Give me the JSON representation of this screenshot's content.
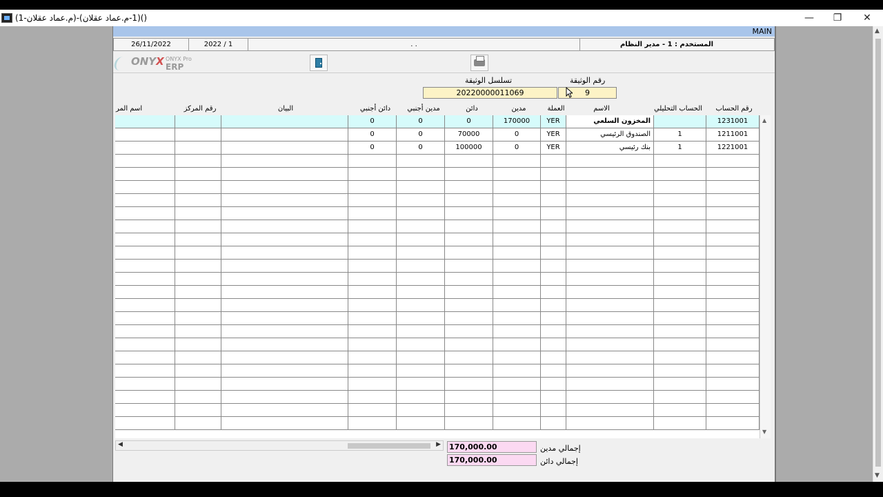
{
  "window": {
    "title": "(1-م.عماد عقلان)-(1-م.عماد عقلان)()",
    "minimize": "—",
    "restore": "❐",
    "close": "✕"
  },
  "form": {
    "main_label": "MAIN",
    "status": {
      "date": "26/11/2022",
      "period": "2022 / 1",
      "middle": ". .",
      "user": "المستخدم : 1 - مدير النظام"
    },
    "logo": {
      "brand": "ONYX",
      "pro": "ONYX Pro",
      "erp": "ERP"
    },
    "document": {
      "sequence_label": "تسلسل الوثيقة",
      "sequence_value": "20220000011069",
      "number_label": "رقم الوثيقة",
      "number_value": "9"
    },
    "columns": {
      "account_no": "رقم الحساب",
      "analytical": "الحساب التحليلي",
      "name": "الاسم",
      "currency": "العملة",
      "debit": "مدين",
      "credit": "دائن",
      "foreign_debit": "مدين أجنبي",
      "foreign_credit": "دائن أجنبي",
      "statement": "البيان",
      "center_no": "رقم المركز",
      "center_name": "اسم المر"
    },
    "rows": [
      {
        "account_no": "1231001",
        "analytical": "",
        "name": "المخزون السلعي",
        "currency": "YER",
        "debit": "170000",
        "credit": "0",
        "foreign_debit": "0",
        "foreign_credit": "0"
      },
      {
        "account_no": "1211001",
        "analytical": "1",
        "name": "الصندوق الرئيسي",
        "currency": "YER",
        "debit": "0",
        "credit": "70000",
        "foreign_debit": "0",
        "foreign_credit": "0"
      },
      {
        "account_no": "1221001",
        "analytical": "1",
        "name": "بنك رئيسي",
        "currency": "YER",
        "debit": "0",
        "credit": "100000",
        "foreign_debit": "0",
        "foreign_credit": "0"
      }
    ],
    "totals": {
      "debit_label": "إجمالي مدين",
      "debit_value": "170,000.00",
      "credit_label": "إجمالي دائن",
      "credit_value": "170,000.00"
    }
  }
}
